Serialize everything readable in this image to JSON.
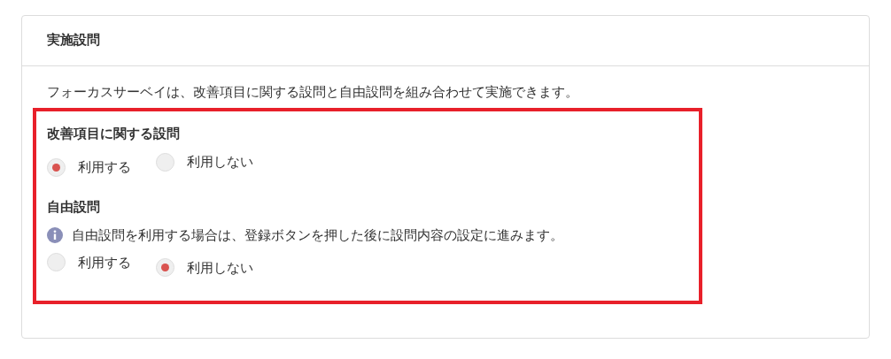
{
  "card": {
    "title": "実施設問",
    "description": "フォーカスサーベイは、改善項目に関する設問と自由設問を組み合わせて実施できます。",
    "highlighted": true
  },
  "sections": [
    {
      "heading": "改善項目に関する設問",
      "options": [
        {
          "label": "利用する",
          "selected": true
        },
        {
          "label": "利用しない",
          "selected": false
        }
      ]
    },
    {
      "heading": "自由設問",
      "note": "自由設問を利用する場合は、登録ボタンを押した後に設問内容の設定に進みます。",
      "options": [
        {
          "label": "利用する",
          "selected": false
        },
        {
          "label": "利用しない",
          "selected": true
        }
      ]
    }
  ]
}
